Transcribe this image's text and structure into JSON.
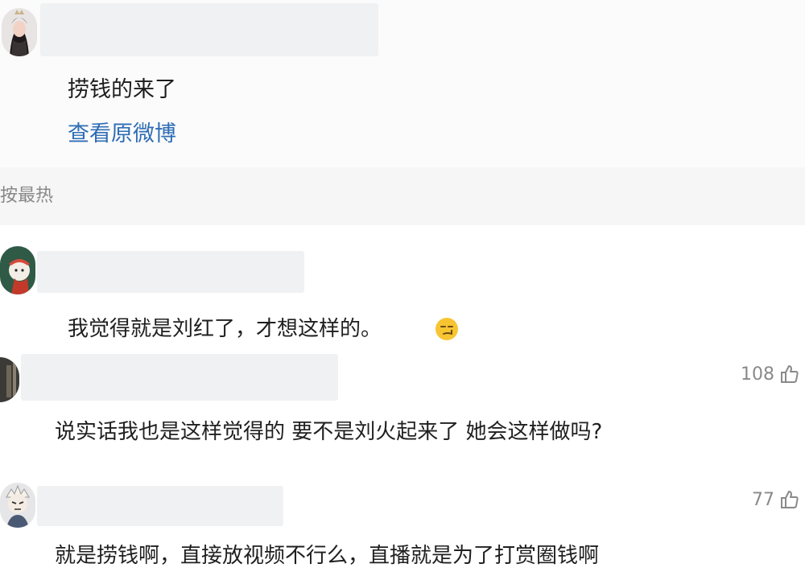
{
  "post": {
    "text": "捞钱的来了",
    "view_original": "查看原微博"
  },
  "sort": {
    "label": "按最热"
  },
  "comments": [
    {
      "text": "我觉得就是刘红了，才想这样的。",
      "emoji": "smirk-face-icon"
    },
    {
      "text": "说实话我也是这样觉得的 要不是刘火起来了 她会这样做吗?",
      "likes": "108"
    },
    {
      "text": "就是捞钱啊，直接放视频不行么，直播就是为了打赏圈钱啊",
      "likes": "77"
    }
  ],
  "colors": {
    "link": "#2f6db5",
    "meta": "#8a8a8a",
    "sort_bg": "#f6f6f7"
  }
}
